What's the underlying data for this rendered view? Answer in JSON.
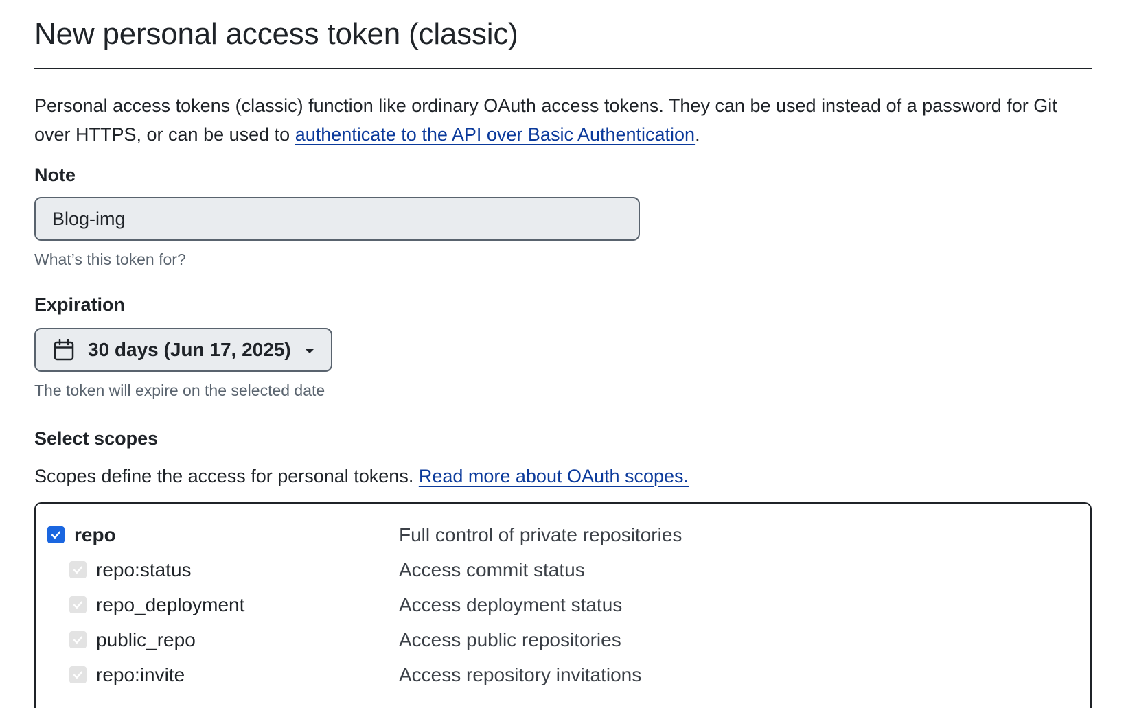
{
  "page": {
    "title": "New personal access token (classic)",
    "intro_text": "Personal access tokens (classic) function like ordinary OAuth access tokens. They can be used instead of a password for Git over HTTPS, or can be used to ",
    "intro_link": "authenticate to the API over Basic Authentication",
    "intro_end": "."
  },
  "note": {
    "label": "Note",
    "value": "Blog-img",
    "hint": "What’s this token for?"
  },
  "expiration": {
    "label": "Expiration",
    "selected": "30 days (Jun 17, 2025)",
    "hint": "The token will expire on the selected date",
    "icon": "calendar-icon"
  },
  "scopes": {
    "label": "Select scopes",
    "description": "Scopes define the access for personal tokens. ",
    "link": "Read more about OAuth scopes.",
    "items": [
      {
        "name": "repo",
        "description": "Full control of private repositories",
        "checked": true,
        "level": "parent"
      },
      {
        "name": "repo:status",
        "description": "Access commit status",
        "checked": true,
        "level": "child"
      },
      {
        "name": "repo_deployment",
        "description": "Access deployment status",
        "checked": true,
        "level": "child"
      },
      {
        "name": "public_repo",
        "description": "Access public repositories",
        "checked": true,
        "level": "child"
      },
      {
        "name": "repo:invite",
        "description": "Access repository invitations",
        "checked": true,
        "level": "child"
      }
    ]
  },
  "colors": {
    "accent": "#1a66e0",
    "link": "#0b3a9b",
    "text": "#1f2328",
    "muted": "#59636e",
    "input_bg": "#e9ecef"
  }
}
